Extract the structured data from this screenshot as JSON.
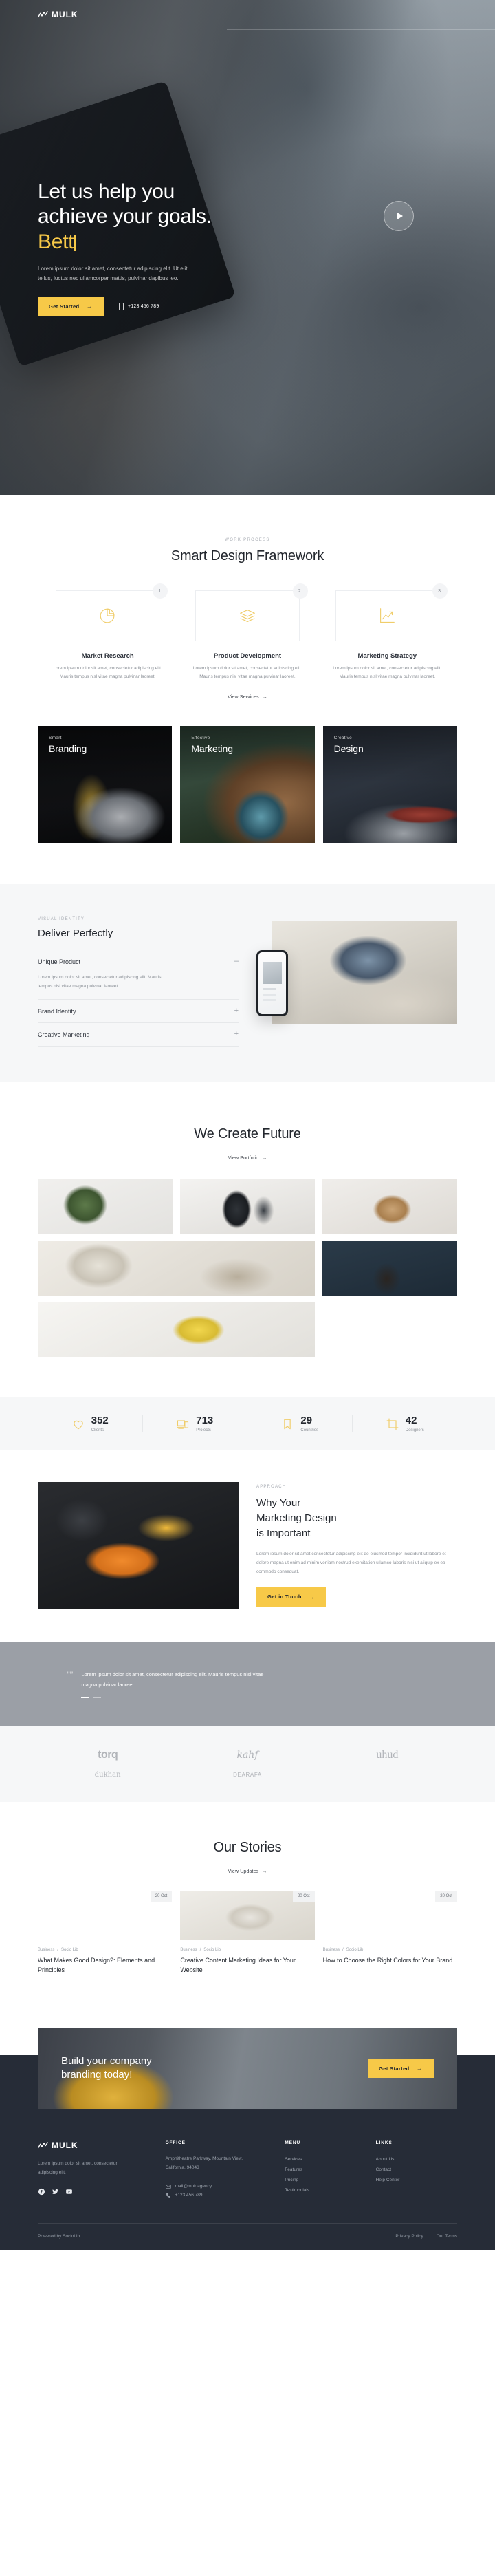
{
  "brand": {
    "name": "MULK",
    "mark_icon": "zigzag-chart-icon"
  },
  "hero": {
    "title_line1": "Let us help you",
    "title_line2": "achieve your goals.",
    "title_accent": "Bett",
    "subtitle": "Lorem ipsum dolor sit amet, consectetur adipiscing elit. Ut elit tellus, luctus nec ullamcorper mattis, pulvinar dapibus leo.",
    "cta_label": "Get Started",
    "cta_arrow": "→",
    "phone": "+123 456 789",
    "play_icon": "play-circle-icon"
  },
  "process": {
    "eyebrow": "WORK PROCESS",
    "title": "Smart Design Framework",
    "link": "View Services",
    "link_arrow": "→",
    "cards": [
      {
        "num": "1.",
        "icon": "pie-chart-icon",
        "name": "Market Research",
        "desc": "Lorem ipsum dolor sit amet, consectetur adipiscing elit. Mauris tempus nisl vitae magna pulvinar laoreet."
      },
      {
        "num": "2.",
        "icon": "layers-icon",
        "name": "Product Development",
        "desc": "Lorem ipsum dolor sit amet, consectetur adipiscing elit. Mauris tempus nisl vitae magna pulvinar laoreet."
      },
      {
        "num": "3.",
        "icon": "growth-chart-icon",
        "name": "Marketing Strategy",
        "desc": "Lorem ipsum dolor sit amet, consectetur adipiscing elit. Mauris tempus nisl vitae magna pulvinar laoreet."
      }
    ]
  },
  "categories": [
    {
      "sub": "Smart",
      "name": "Branding"
    },
    {
      "sub": "Effective",
      "name": "Marketing"
    },
    {
      "sub": "Creative",
      "name": "Design"
    }
  ],
  "deliver": {
    "eyebrow": "VISUAL IDENTITY",
    "title": "Deliver Perfectly",
    "items": [
      {
        "label": "Unique Product",
        "sign": "–",
        "open": true,
        "body": "Lorem ipsum dolor sit amet, consectetur adipiscing elit. Mauris tempus nisl vitae magna pulvinar laoreet."
      },
      {
        "label": "Brand Identity",
        "sign": "+",
        "open": false,
        "body": ""
      },
      {
        "label": "Creative Marketing",
        "sign": "+",
        "open": false,
        "body": ""
      }
    ]
  },
  "portfolio": {
    "title": "We Create Future",
    "link": "View Portfolio",
    "link_arrow": "→"
  },
  "stats": [
    {
      "icon": "heart-icon",
      "value": "352",
      "label": "Clients"
    },
    {
      "icon": "devices-icon",
      "value": "713",
      "label": "Projects"
    },
    {
      "icon": "bookmark-icon",
      "value": "29",
      "label": "Countries"
    },
    {
      "icon": "crop-icon",
      "value": "42",
      "label": "Designers"
    }
  ],
  "approach": {
    "eyebrow": "APPROACH",
    "title_line1": "Why Your",
    "title_line2": "Marketing Design",
    "title_line3": "is Important",
    "desc": "Lorem ipsum dolor sit amet consectetur adipiscing elit do eiusmod tempor incididunt ut labore et dolore magna ut enim ad minim veniam nostrud exercitation ullamco laboris nisi ut aliquip ex ea commodo consequat.",
    "cta_label": "Get in Touch",
    "cta_arrow": "→"
  },
  "quote": {
    "mark": "””",
    "text": "Lorem ipsum dolor sit amet, consectetur adipiscing elit. Mauris tempus nisl vitae magna pulvinar laoreet."
  },
  "logos": {
    "row1": [
      "torq",
      "kahf",
      "uhud"
    ],
    "row2": [
      "dukhan",
      "DEARAFA"
    ]
  },
  "stories": {
    "title": "Our Stories",
    "link": "View Updates",
    "link_arrow": "→",
    "posts": [
      {
        "date": "20 Oct",
        "cat": "Business",
        "sep": "/",
        "tag": "Socio Lib",
        "title": "What Makes Good Design?: Elements and Principles"
      },
      {
        "date": "20 Oct",
        "cat": "Business",
        "sep": "/",
        "tag": "Socio Lib",
        "title": "Creative Content Marketing Ideas for Your Website"
      },
      {
        "date": "20 Oct",
        "cat": "Business",
        "sep": "/",
        "tag": "Socio Lib",
        "title": "How to Choose the Right Colors for Your Brand"
      }
    ]
  },
  "cta": {
    "title_line1": "Build your company",
    "title_line2": "branding today!",
    "button": "Get Started",
    "button_arrow": "→"
  },
  "footer": {
    "about": "Lorem ipsum dolor sit amet, consectetur adipiscing elit.",
    "social": [
      "facebook-icon",
      "twitter-icon",
      "youtube-icon"
    ],
    "office_head": "OFFICE",
    "office_addr": "Amphitheatre Parkway, Mountain View, California, 94043",
    "email": "mail@muk.agency",
    "phone": "+123 456 789",
    "menu_head": "MENU",
    "menu": [
      "Services",
      "Features",
      "Pricing",
      "Testimonials"
    ],
    "links_head": "LINKS",
    "links": [
      "About Us",
      "Contact",
      "Help Center"
    ],
    "copyright": "Powered by SocioLib.",
    "legal": [
      "Privacy Policy",
      "Our Terms"
    ]
  },
  "colors": {
    "accent": "#f7c948",
    "dark": "#262c37",
    "muted_gray": "#9b9fa6",
    "light_bg": "#f6f7f8"
  }
}
